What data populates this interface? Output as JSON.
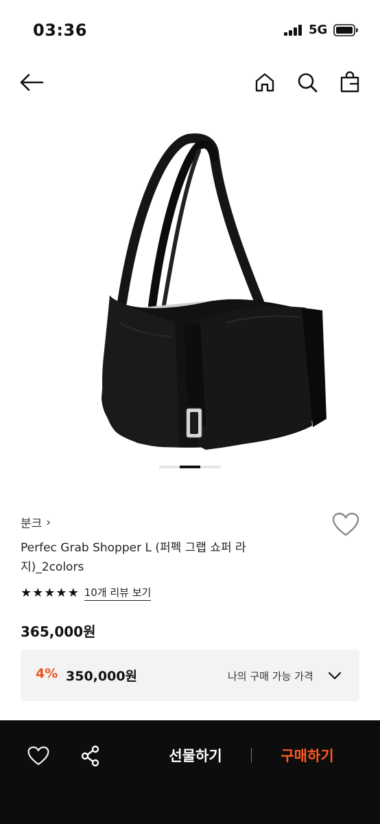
{
  "status_bar": {
    "time": "03:36",
    "network": "5G"
  },
  "top_nav": {
    "back_icon": "arrow-left-icon",
    "home_icon": "home-icon",
    "search_icon": "search-icon",
    "cart_icon": "shopping-bag-icon"
  },
  "product": {
    "image_alt_icon": "black-tote-bag-image",
    "brand": "분크",
    "brand_chevron": "›",
    "name": "Perfec Grab Shopper L (퍼펙 그랩 쇼퍼 라지)_2colors",
    "rating_stars": 5,
    "review_link": "10개 리뷰 보기",
    "list_price": "365,000원"
  },
  "my_price": {
    "discount_rate": "4%",
    "price": "350,000원",
    "label": "나의 구매 가능 가격"
  },
  "bottom_bar": {
    "gift_label": "선물하기",
    "buy_label": "구매하기"
  },
  "colors": {
    "accent": "#ff5a1f",
    "bar_bg": "#0d0d0d"
  }
}
